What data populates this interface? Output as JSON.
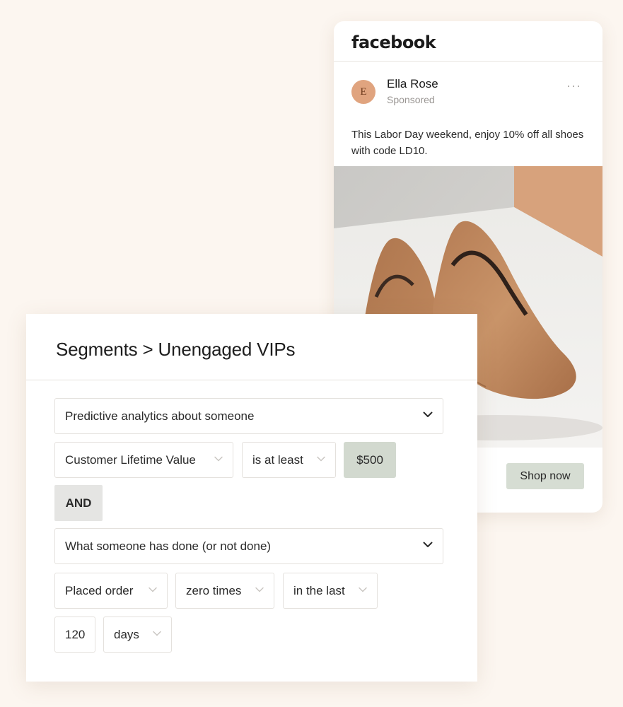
{
  "facebook_ad": {
    "brand": "facebook",
    "author": "Ella Rose",
    "author_initial": "E",
    "sponsored_label": "Sponsored",
    "more_label": "···",
    "post_text": "This Labor Day weekend, enjoy 10% off all shoes with code LD10.",
    "image_alt": "Pair of tan suede pointed-toe heels",
    "cta_label": "Shop now"
  },
  "segment": {
    "title": "Segments > Unengaged VIPs",
    "condition_1": {
      "type": "Predictive analytics about someone",
      "field": "Customer Lifetime Value",
      "operator": "is at least",
      "value": "$500"
    },
    "joiner": "AND",
    "condition_2": {
      "type": "What someone has done (or not done)",
      "action": "Placed order",
      "frequency": "zero times",
      "timeframe": "in the last",
      "amount": "120",
      "unit": "days"
    }
  },
  "colors": {
    "page_background": "#fcf6f0",
    "value_chip": "#d2d9cf",
    "cta_button": "#d6ddd3",
    "avatar": "#e0a47f",
    "shoe": "#c08a62"
  }
}
